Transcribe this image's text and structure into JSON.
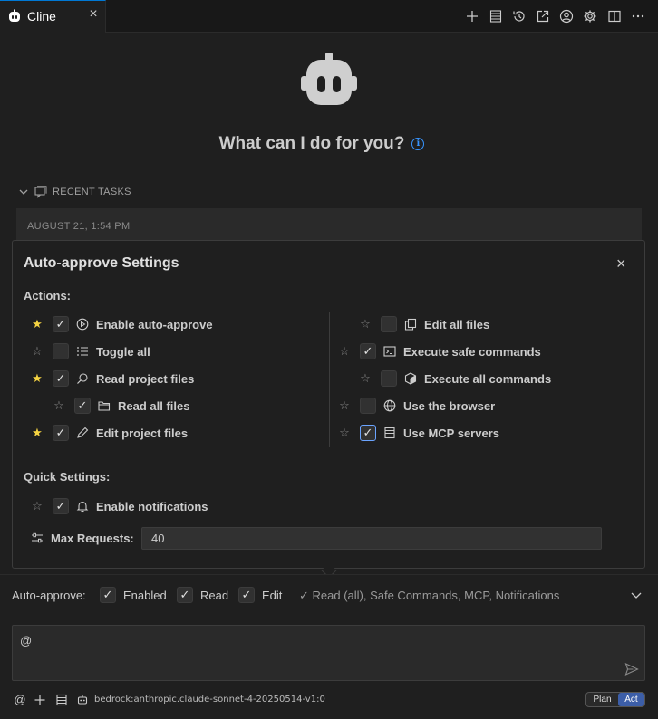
{
  "tab": {
    "title": "Cline",
    "icon": "cline-robot-icon"
  },
  "header_icons": [
    "plus-icon",
    "server-icon",
    "history-icon",
    "popout-icon",
    "account-icon",
    "gear-icon",
    "split-icon",
    "more-icon"
  ],
  "welcome": {
    "heading": "What can I do for you?"
  },
  "recent": {
    "label": "RECENT TASKS",
    "first_date": "AUGUST 21, 1:54 PM"
  },
  "panel": {
    "title": "Auto-approve Settings",
    "actions_label": "Actions:",
    "left_actions": [
      {
        "label": "Enable auto-approve",
        "starred": true,
        "checked": true,
        "icon": "play-circle-icon"
      },
      {
        "label": "Toggle all",
        "starred": false,
        "checked": false,
        "icon": "list-icon"
      },
      {
        "label": "Read project files",
        "starred": true,
        "checked": true,
        "icon": "search-icon"
      },
      {
        "label": "Read all files",
        "starred": false,
        "checked": true,
        "icon": "folder-icon"
      },
      {
        "label": "Edit project files",
        "starred": true,
        "checked": true,
        "icon": "pencil-icon"
      }
    ],
    "right_actions": [
      {
        "label": "Edit all files",
        "starred": false,
        "checked": false,
        "icon": "copy-icon"
      },
      {
        "label": "Execute safe commands",
        "starred": false,
        "checked": true,
        "icon": "terminal-icon"
      },
      {
        "label": "Execute all commands",
        "starred": false,
        "checked": false,
        "icon": "cube-icon"
      },
      {
        "label": "Use the browser",
        "starred": false,
        "checked": false,
        "icon": "globe-icon"
      },
      {
        "label": "Use MCP servers",
        "starred": false,
        "checked": true,
        "icon": "server-icon"
      }
    ],
    "quick_label": "Quick Settings:",
    "notifications": {
      "label": "Enable notifications",
      "starred": false,
      "checked": true
    },
    "max_requests": {
      "label": "Max Requests:",
      "value": "40"
    }
  },
  "auto_approve_bar": {
    "label": "Auto-approve:",
    "items": [
      "Enabled",
      "Read",
      "Edit"
    ],
    "summary": "✓ Read (all), Safe Commands, MCP, Notifications"
  },
  "chat_input": {
    "value": "@"
  },
  "footer": {
    "model": "bedrock:anthropic.claude-sonnet-4-20250514-v1:0",
    "mode_plan": "Plan",
    "mode_act": "Act"
  },
  "colors": {
    "accent": "#0078d4",
    "star": "#f5d342",
    "info": "#3794ff",
    "act": "#3c5ea8"
  }
}
